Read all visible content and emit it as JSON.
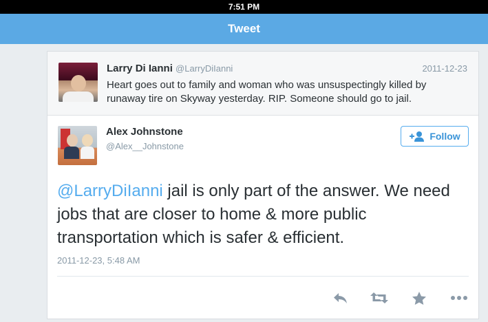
{
  "status_bar": {
    "time": "7:51 PM"
  },
  "nav": {
    "title": "Tweet"
  },
  "reply_to": {
    "name": "Larry Di Ianni",
    "handle": "@LarryDiIanni",
    "date": "2011-12-23",
    "text": "Heart goes out to family and woman who was unsuspectingly killed by runaway tire on Skyway yesterday. RIP.  Someone should go to jail."
  },
  "tweet": {
    "name": "Alex Johnstone",
    "handle": "@Alex__Johnstone",
    "follow_label": "Follow",
    "mention": "@LarryDiIanni",
    "text": " jail is only part of the answer. We need jobs that are closer to home & more public transportation which is safer & efficient.",
    "timestamp": "2011-12-23, 5:48 AM"
  },
  "actions": [
    {
      "icon": "reply-icon"
    },
    {
      "icon": "retweet-icon"
    },
    {
      "icon": "favorite-icon"
    },
    {
      "icon": "more-icon"
    }
  ],
  "colors": {
    "nav_bar": "#5ba9e4",
    "accent": "#55acee",
    "text": "#292f33",
    "muted": "#8899a6",
    "action_icons": "#8b9aa8"
  }
}
